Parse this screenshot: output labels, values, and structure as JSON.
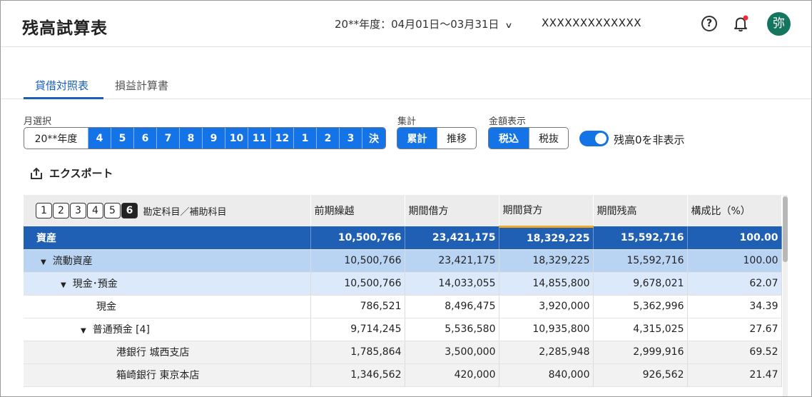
{
  "header": {
    "title": "残高試算表",
    "period": "20**年度：04月01日〜03月31日",
    "company": "XXXXXXXXXXXXX",
    "help": "?",
    "avatar": "弥"
  },
  "tabs": [
    {
      "label": "貸借対照表"
    },
    {
      "label": "損益計算書"
    }
  ],
  "filters": {
    "month_label": "月選択",
    "months": [
      "20**年度",
      "4",
      "5",
      "6",
      "7",
      "8",
      "9",
      "10",
      "11",
      "12",
      "1",
      "2",
      "3",
      "決"
    ],
    "aggregate_label": "集計",
    "aggregate": [
      "累計",
      "推移"
    ],
    "amount_label": "金額表示",
    "amount": [
      "税込",
      "税抜"
    ],
    "hide_zero_label": "残高0を非表示"
  },
  "export_label": "エクスポート",
  "table": {
    "levels": [
      "1",
      "2",
      "3",
      "4",
      "5",
      "6"
    ],
    "account_header": "勘定科目／補助科目",
    "columns": [
      "前期繰越",
      "期間借方",
      "期間貸方",
      "期間残高",
      "構成比（%）"
    ],
    "rows": [
      {
        "name": "資産",
        "prior": "10,500,766",
        "debit": "23,421,175",
        "credit": "18,329,225",
        "balance": "15,592,716",
        "ratio": "100.00"
      },
      {
        "name": "流動資産",
        "prior": "10,500,766",
        "debit": "23,421,175",
        "credit": "18,329,225",
        "balance": "15,592,716",
        "ratio": "100.00"
      },
      {
        "name": "現金･預金",
        "prior": "10,500,766",
        "debit": "14,033,055",
        "credit": "14,855,800",
        "balance": "9,678,021",
        "ratio": "62.07"
      },
      {
        "name": "現金",
        "prior": "786,521",
        "debit": "8,496,475",
        "credit": "3,920,000",
        "balance": "5,362,996",
        "ratio": "34.39"
      },
      {
        "name": "普通預金 [4]",
        "prior": "9,714,245",
        "debit": "5,536,580",
        "credit": "10,935,800",
        "balance": "4,315,025",
        "ratio": "27.67"
      },
      {
        "name": "港銀行 城西支店",
        "prior": "1,785,864",
        "debit": "3,500,000",
        "credit": "2,285,948",
        "balance": "2,999,916",
        "ratio": "69.52"
      },
      {
        "name": "箱崎銀行 東京本店",
        "prior": "1,346,562",
        "debit": "420,000",
        "credit": "840,000",
        "balance": "926,562",
        "ratio": "21.47"
      }
    ]
  }
}
